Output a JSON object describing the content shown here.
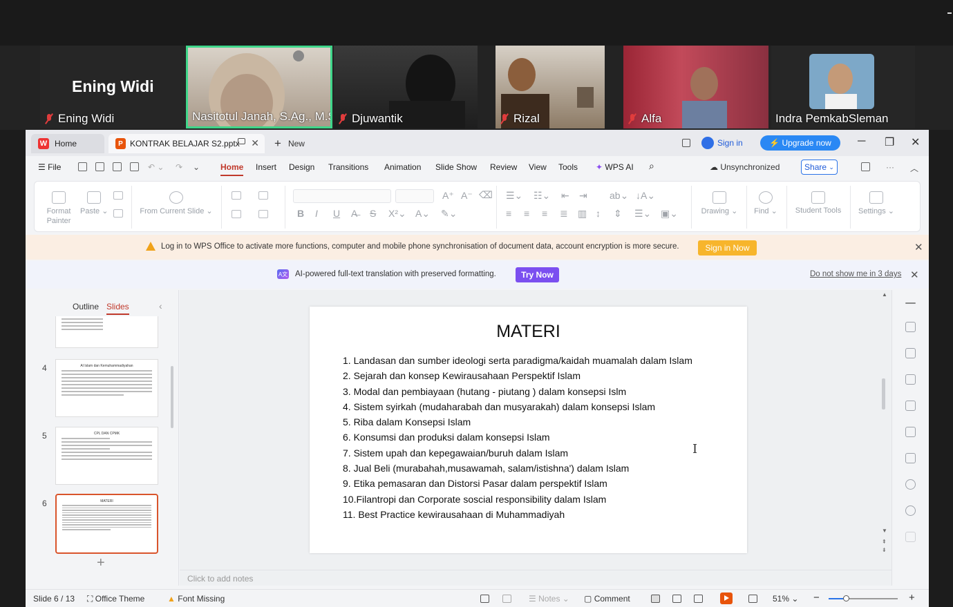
{
  "meeting": {
    "active_name": "Ening Widi",
    "participants": [
      {
        "name": "Ening Widi",
        "muted": true
      },
      {
        "name": "Nasitotul Janah, S.Ag., M.S.I",
        "muted": false
      },
      {
        "name": "Djuwantik",
        "muted": true
      },
      {
        "name": "Rizal",
        "muted": true
      },
      {
        "name": "Alfa",
        "muted": true
      },
      {
        "name": "Indra PemkabSleman",
        "muted": false
      }
    ]
  },
  "wps": {
    "tabs": {
      "home": "Home",
      "doc": "KONTRAK BELAJAR S2.pptx",
      "new": "New"
    },
    "sign_in": "Sign in",
    "upgrade": "Upgrade now",
    "menu": {
      "file": "File",
      "items": [
        "Home",
        "Insert",
        "Design",
        "Transitions",
        "Animation",
        "Slide Show",
        "Review",
        "View",
        "Tools"
      ],
      "wps_ai": "WPS AI",
      "unsync": "Unsynchronized",
      "share": "Share"
    },
    "ribbon": {
      "format_painter": "Format Painter",
      "paste": "Paste",
      "from_current": "From Current Slide",
      "drawing": "Drawing",
      "find": "Find",
      "student_tools": "Student Tools",
      "settings": "Settings"
    },
    "warn": {
      "text": "Log in to WPS Office to activate more functions, computer and mobile phone synchronisation of document data, account encryption is more secure.",
      "button": "Sign in Now"
    },
    "ai": {
      "text": "AI-powered full-text translation with preserved formatting.",
      "button": "Try Now",
      "dismiss": "Do not show me in 3 days"
    },
    "left_panel": {
      "outline": "Outline",
      "slides": "Slides",
      "thumbs": [
        {
          "num": "4",
          "title": "Al Islam dan Kemuhammadiyahan"
        },
        {
          "num": "5",
          "title": "CPL DAN CPMK"
        },
        {
          "num": "6",
          "title": "MATERI"
        }
      ]
    },
    "slide": {
      "title": "MATERI",
      "items": [
        "1.  Landasan dan sumber ideologi serta paradigma/kaidah muamalah dalam Islam",
        "2.  Sejarah dan konsep Kewirausahaan Perspektif Islam",
        "3.  Modal dan pembiayaan (hutang - piutang ) dalam konsepsi Islm",
        "4.  Sistem syirkah (mudaharabah dan musyarakah)  dalam konsepsi Islam",
        "5.  Riba dalam Konsepsi Islam",
        "6.  Konsumsi dan produksi dalam konsepsi Islam",
        "7.  Sistem upah dan kepegawaian/buruh dalam Islam",
        "8.  Jual Beli (murabahah,musawamah, salam/istishna') dalam Islam",
        "9.  Etika pemasaran dan Distorsi Pasar dalam perspektif Islam",
        "10.Filantropi dan Corporate soscial responsibility dalam Islam",
        "11. Best Practice kewirausahaan di Muhammadiyah"
      ]
    },
    "notes_placeholder": "Click to add notes",
    "status": {
      "slide": "Slide 6 / 13",
      "theme": "Office Theme",
      "font_missing": "Font Missing",
      "notes": "Notes",
      "comment": "Comment",
      "zoom": "51%",
      "zoom_fraction": 0.25
    }
  }
}
